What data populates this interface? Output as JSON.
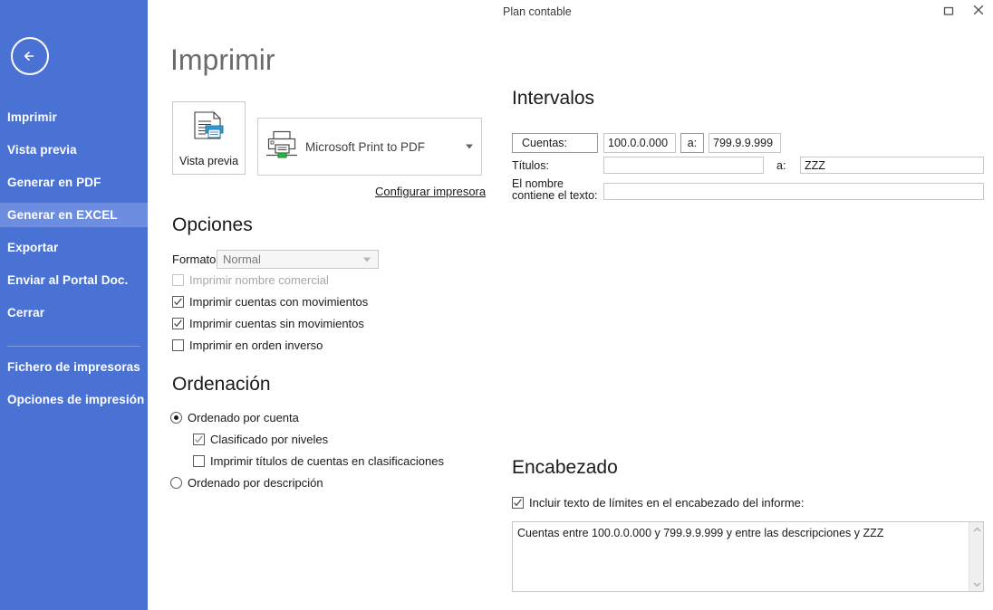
{
  "window": {
    "title": "Plan contable",
    "restore_icon": "restore-icon",
    "close_icon": "close-icon"
  },
  "sidebar": {
    "back_icon": "back-arrow-icon",
    "accent": "#4a72d4",
    "active_bg": "#6d8ee0",
    "items": [
      {
        "label": "Imprimir",
        "active": false
      },
      {
        "label": "Vista previa",
        "active": false
      },
      {
        "label": "Generar en PDF",
        "active": false
      },
      {
        "label": "Generar en EXCEL",
        "active": true
      },
      {
        "label": "Exportar",
        "active": false
      },
      {
        "label": "Enviar al Portal Doc.",
        "active": false
      },
      {
        "label": "Cerrar",
        "active": false
      }
    ],
    "footer_items": [
      {
        "label": "Fichero de impresoras"
      },
      {
        "label": "Opciones de impresión"
      }
    ]
  },
  "print": {
    "heading": "Imprimir",
    "preview_button_label": "Vista previa",
    "preview_icon": "document-preview-icon",
    "printer_icon": "printer-icon",
    "printer_name": "Microsoft Print to PDF",
    "configure_link": "Configurar impresora"
  },
  "opciones": {
    "heading": "Opciones",
    "formato_label": "Formato:",
    "formato_value": "Normal",
    "formato_options": [
      "Normal"
    ],
    "checkboxes": [
      {
        "label": "Imprimir nombre comercial",
        "checked": false,
        "disabled": true
      },
      {
        "label": "Imprimir cuentas con movimientos",
        "checked": true,
        "disabled": false
      },
      {
        "label": "Imprimir cuentas sin movimientos",
        "checked": true,
        "disabled": false
      },
      {
        "label": "Imprimir en orden inverso",
        "checked": false,
        "disabled": false
      }
    ]
  },
  "ordenacion": {
    "heading": "Ordenación",
    "radio_cuenta": {
      "label": "Ordenado por cuenta",
      "selected": true
    },
    "radio_descripcion": {
      "label": "Ordenado por descripción",
      "selected": false
    },
    "sub_checkboxes": [
      {
        "label": "Clasificado por niveles",
        "checked": true
      },
      {
        "label": "Imprimir títulos de cuentas en clasificaciones",
        "checked": false
      }
    ]
  },
  "intervalos": {
    "heading": "Intervalos",
    "cuentas_label": "Cuentas:",
    "cuentas_from": "100.0.0.000",
    "cuentas_to": "799.9.9.999",
    "a_label_1": "a:",
    "titulos_label": "Títulos:",
    "titulos_from": "",
    "titulos_to": "ZZZ",
    "a_label_2": "a:",
    "nombre_label_line1": "El nombre",
    "nombre_label_line2": "contiene el texto:",
    "nombre_value": ""
  },
  "encabezado": {
    "heading": "Encabezado",
    "include_label": "Incluir texto de límites en el encabezado del informe:",
    "include_checked": true,
    "text": "Cuentas entre 100.0.0.000 y 799.9.9.999 y entre las descripciones  y ZZZ",
    "scroll_up_icon": "chevron-up-icon",
    "scroll_down_icon": "chevron-down-icon"
  }
}
